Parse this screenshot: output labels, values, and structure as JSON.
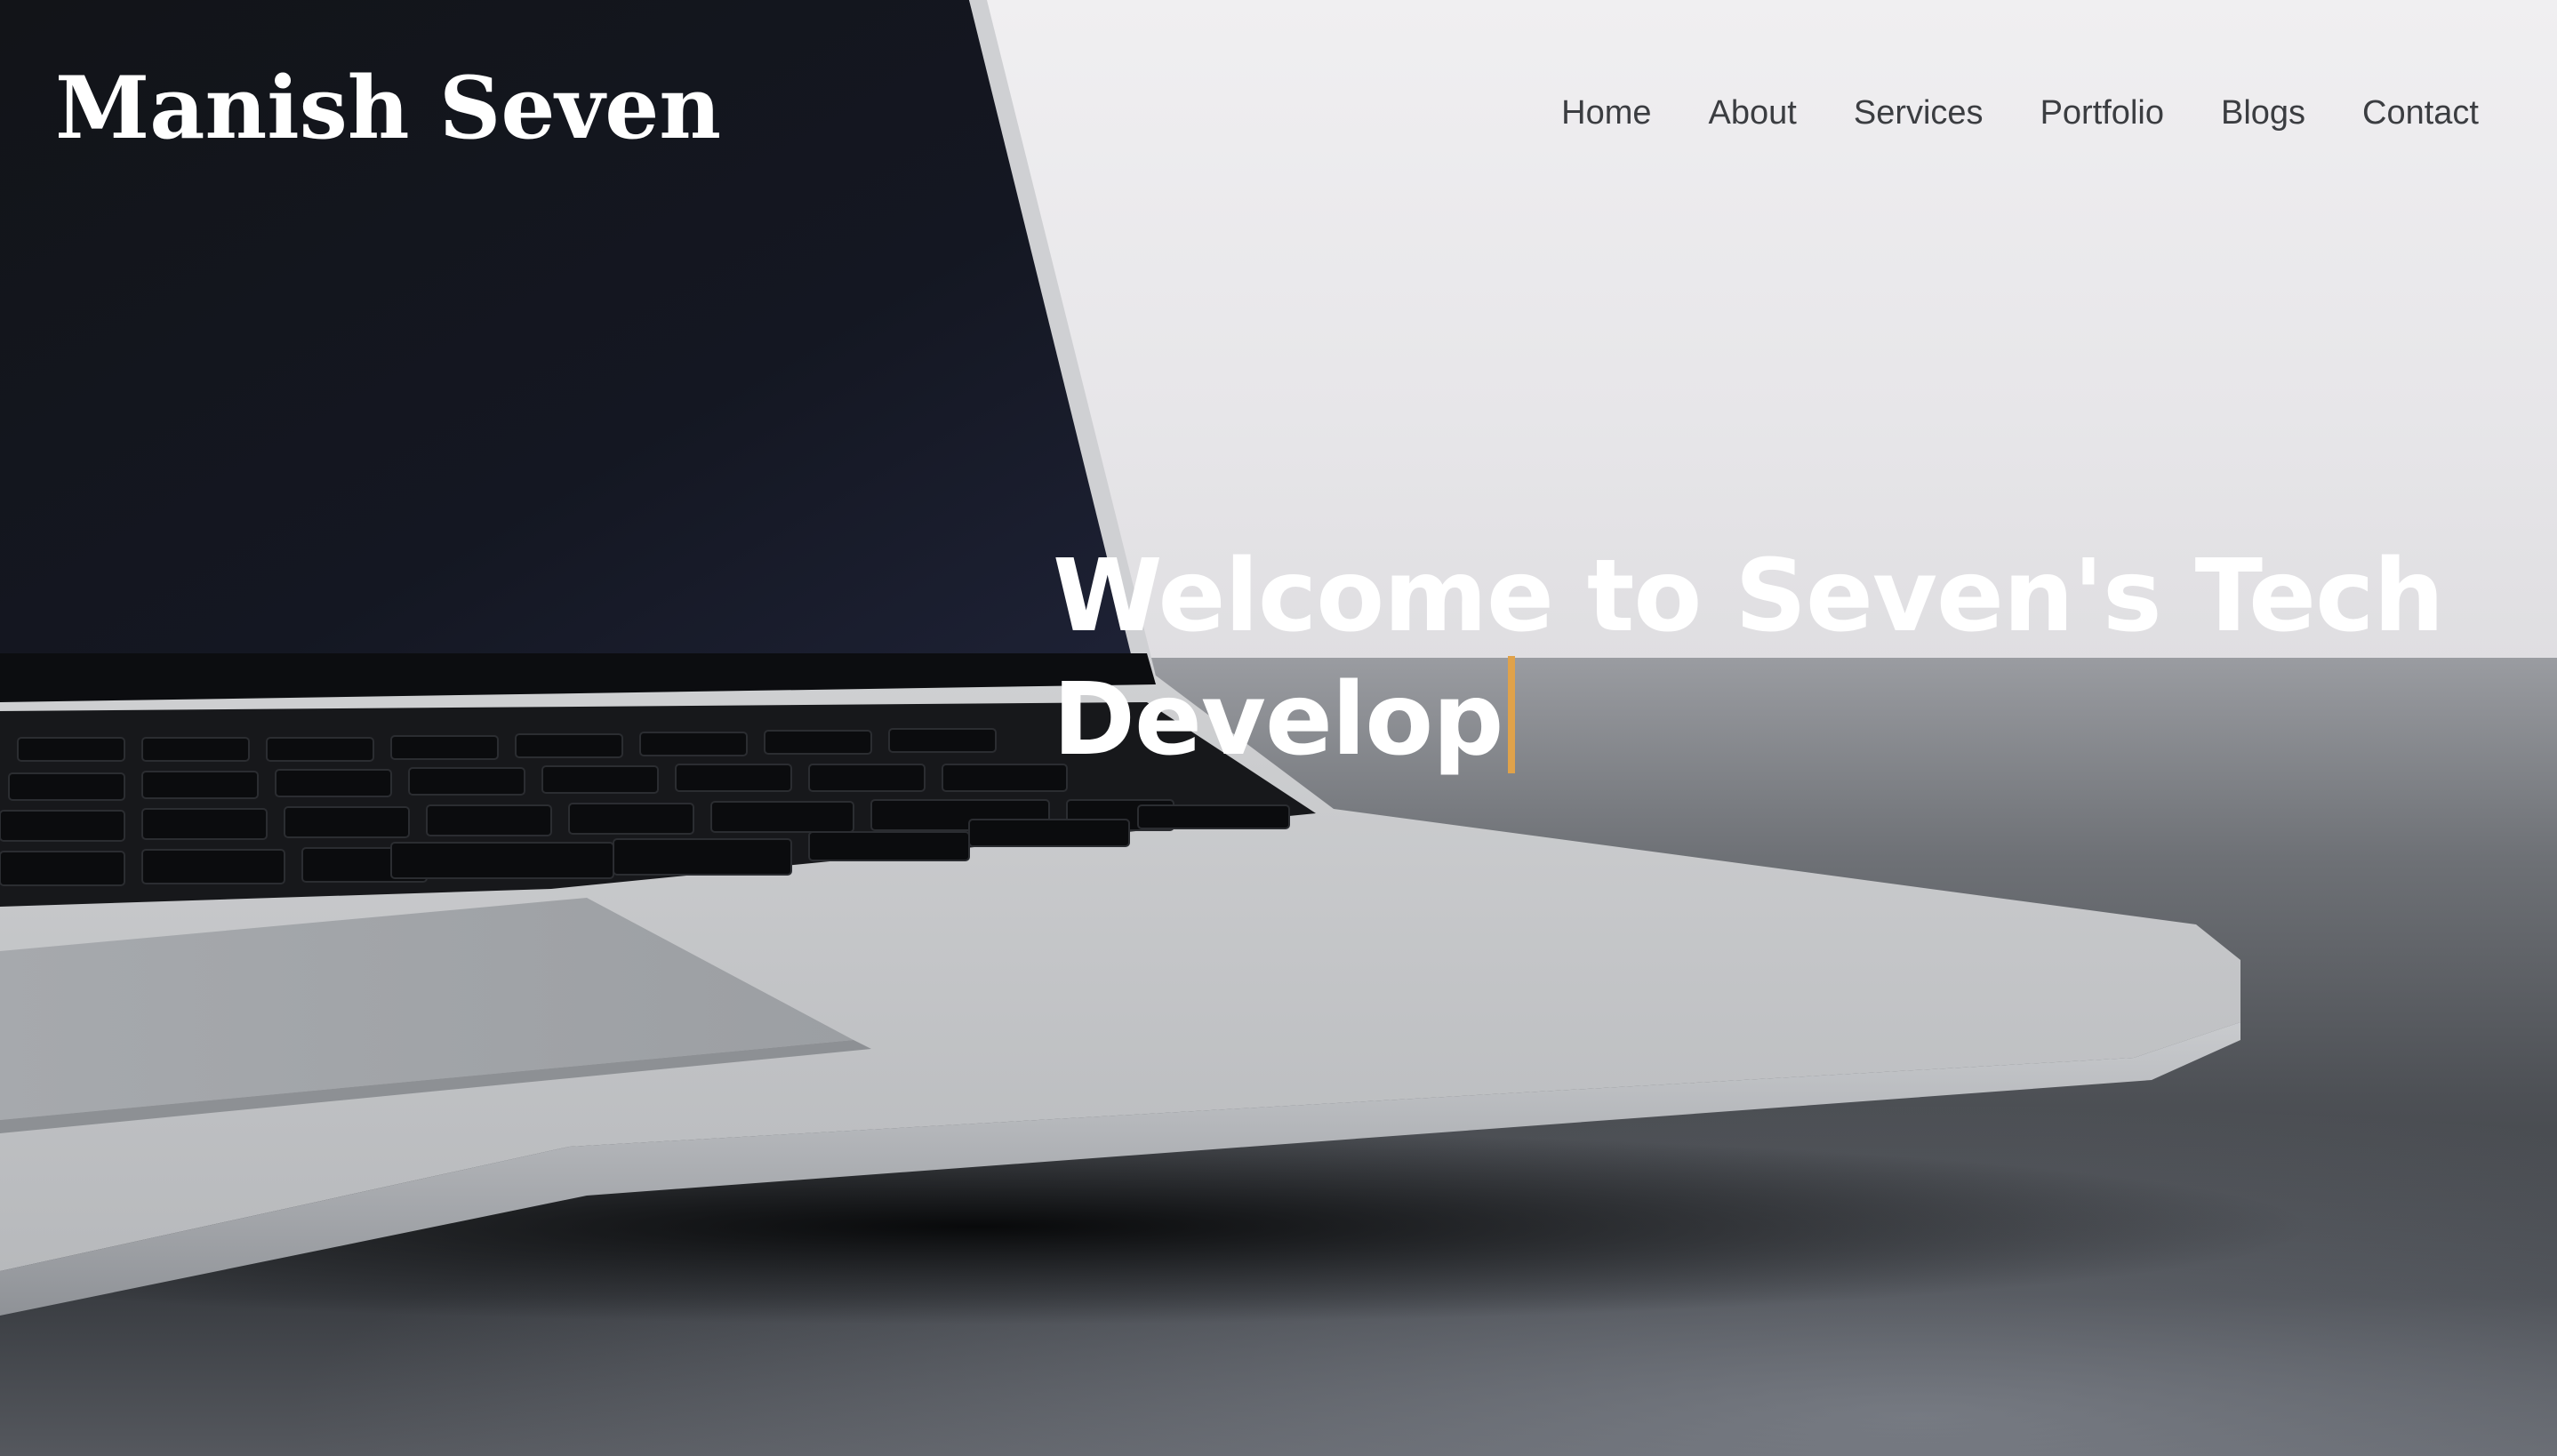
{
  "brand": {
    "name": "Manish Seven"
  },
  "nav": {
    "items": [
      {
        "label": "Home"
      },
      {
        "label": "About"
      },
      {
        "label": "Services"
      },
      {
        "label": "Portfolio"
      },
      {
        "label": "Blogs"
      },
      {
        "label": "Contact"
      }
    ]
  },
  "hero": {
    "title_line_1": "Welcome to Seven's Tech",
    "title_line_2": "Develop",
    "cursor_color": "#e0a24a",
    "background_image": "laptop-on-desk-photo"
  },
  "colors": {
    "brand_text": "#ffffff",
    "nav_text": "#3b3d41",
    "hero_text": "#ffffff",
    "accent": "#e0a24a"
  }
}
